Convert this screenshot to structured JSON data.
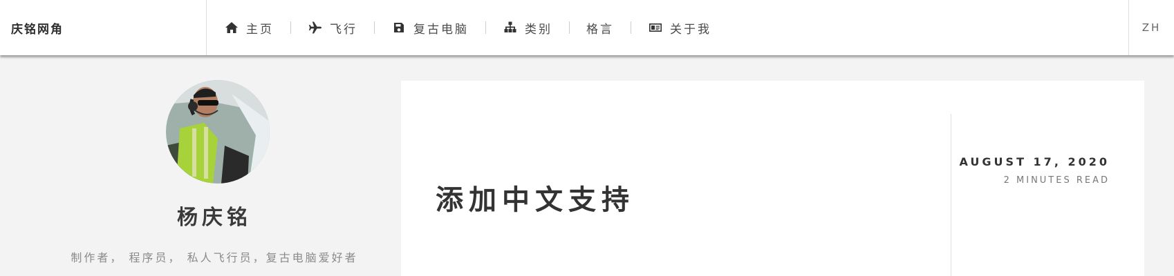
{
  "header": {
    "brand": "庆铭网角",
    "nav": [
      {
        "label": "主页",
        "icon": "home-icon"
      },
      {
        "label": "飞行",
        "icon": "plane-icon"
      },
      {
        "label": "复古电脑",
        "icon": "floppy-disk-icon"
      },
      {
        "label": "类别",
        "icon": "sitemap-icon"
      },
      {
        "label": "格言",
        "icon": ""
      },
      {
        "label": "关于我",
        "icon": "id-card-icon"
      }
    ],
    "language": "ZH"
  },
  "sidebar": {
    "avatar_icon": "avatar-photo",
    "name": "杨庆铭",
    "bio": "制作者， 程序员， 私人飞行员，复古电脑爱好者"
  },
  "post": {
    "title": "添加中文支持",
    "date": "AUGUST 17, 2020",
    "read_time": "2 MINUTES READ"
  },
  "colors": {
    "background": "#f3f3f3",
    "card": "#ffffff",
    "text": "#333333",
    "muted": "#8a8a8a"
  }
}
